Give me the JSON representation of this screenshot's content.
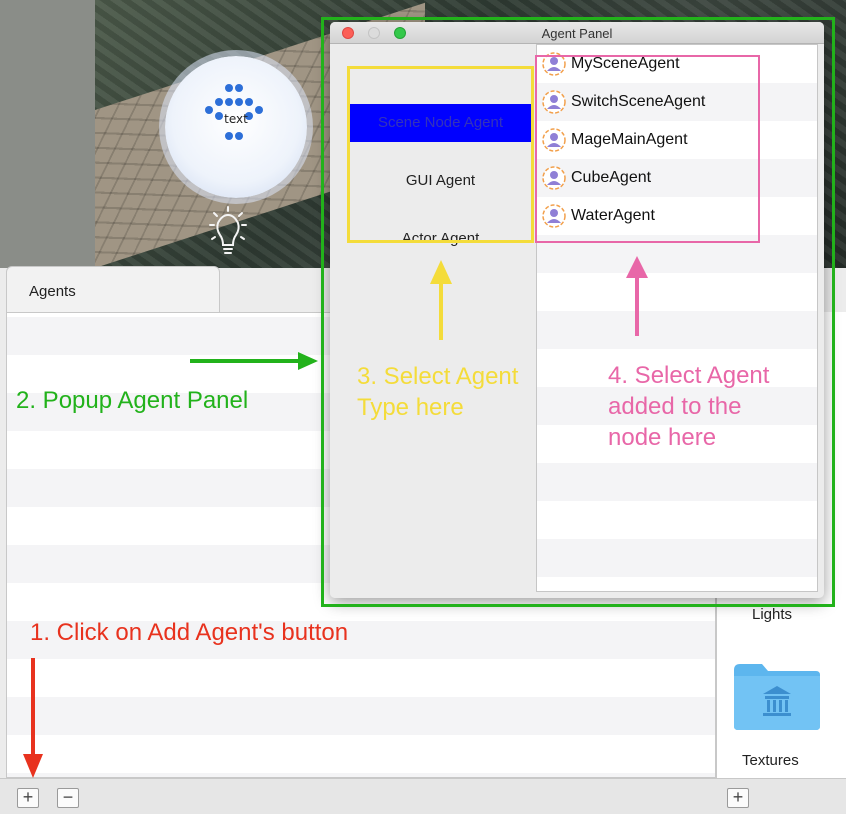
{
  "viewport": {
    "sun_label": "text"
  },
  "agents_panel": {
    "tab_label": "Agents",
    "add_button": "+",
    "remove_button": "−"
  },
  "assets": {
    "lights_label": "Lights",
    "textures_label": "Textures",
    "add_button": "+"
  },
  "agent_window": {
    "title": "Agent Panel",
    "agent_types": [
      {
        "label": "Scene Node Agent",
        "selected": true
      },
      {
        "label": "GUI Agent",
        "selected": false
      },
      {
        "label": "Actor Agent",
        "selected": false
      }
    ],
    "agents": [
      {
        "name": "MySceneAgent"
      },
      {
        "name": "SwitchSceneAgent"
      },
      {
        "name": "MageMainAgent"
      },
      {
        "name": "CubeAgent"
      },
      {
        "name": "WaterAgent"
      }
    ]
  },
  "annotations": {
    "step1": "1. Click on Add Agent's button",
    "step2": "2. Popup Agent Panel",
    "step3_line1": "3. Select Agent",
    "step3_line2": "Type here",
    "step4_line1": "4. Select Agent",
    "step4_line2": "added to the",
    "step4_line3": "node here"
  },
  "colors": {
    "step1": "#e8321e",
    "step2": "#22b21b",
    "step3": "#f4dc3a",
    "step4": "#e867a8",
    "selection": "#0000ff"
  }
}
